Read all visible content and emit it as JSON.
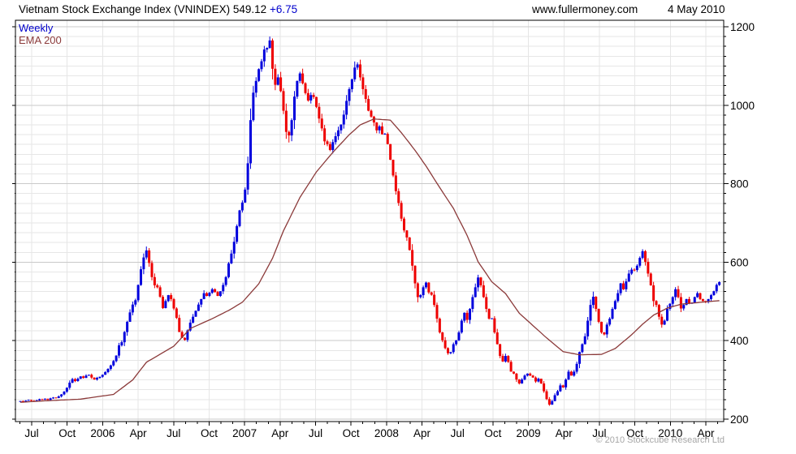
{
  "header": {
    "title": "Vietnam Stock Exchange Index (VNINDEX)",
    "last_value": "549.12",
    "change": "+6.75",
    "site": "www.fullermoney.com",
    "date": "4 May 2010"
  },
  "legend": {
    "series1": "Weekly",
    "series2": "EMA 200"
  },
  "footer": {
    "copyright": "© 2010 Stockcube Research Ltd"
  },
  "colors": {
    "up": "#0000dd",
    "down": "#ee0000",
    "ema": "#8b3a3a",
    "grid_minor": "#e6e6e6",
    "grid_major": "#c9c9c9",
    "axis": "#000000",
    "label": "#000000",
    "change_text": "#0000cc",
    "copyright_text": "#a6a6a6"
  },
  "chart_data": {
    "type": "candlestick",
    "title": "Vietnam Stock Exchange Index (VNINDEX)",
    "frequency": "Weekly",
    "overlay": "EMA 200",
    "last": 549.12,
    "change": 6.75,
    "date": "4 May 2010",
    "start": "Jun 2005",
    "end": "May 2010",
    "ylim": [
      200,
      1200
    ],
    "y_ticks": [
      1200,
      1000,
      800,
      600,
      400,
      200
    ],
    "y_minor_step": 25,
    "x_tick_labels": [
      "Jul",
      "Oct",
      "2006",
      "Apr",
      "Jul",
      "Oct",
      "2007",
      "Apr",
      "Jul",
      "Oct",
      "2008",
      "Apr",
      "Jul",
      "Oct",
      "2009",
      "Apr",
      "Jul",
      "Oct",
      "2010",
      "Apr"
    ],
    "grid": true,
    "legend_position": "top-left",
    "weekly_closes": [
      246,
      244,
      247,
      249,
      247,
      246,
      248,
      251,
      250,
      252,
      249,
      253,
      255,
      254,
      258,
      263,
      270,
      280,
      293,
      302,
      297,
      303,
      309,
      305,
      311,
      313,
      306,
      301,
      305,
      308,
      313,
      320,
      328,
      337,
      348,
      362,
      388,
      396,
      422,
      448,
      472,
      492,
      503,
      542,
      582,
      612,
      630,
      598,
      562,
      541,
      536,
      512,
      483,
      501,
      516,
      506,
      482,
      458,
      422,
      407,
      402,
      426,
      446,
      461,
      476,
      492,
      506,
      521,
      514,
      522,
      531,
      524,
      514,
      526,
      542,
      562,
      597,
      622,
      652,
      692,
      732,
      752,
      785,
      852,
      962,
      1032,
      1062,
      1092,
      1112,
      1142,
      1146,
      1165,
      1093,
      1052,
      1071,
      1036,
      986,
      932,
      923,
      962,
      1022,
      1062,
      1081,
      1056,
      1031,
      1012,
      1026,
      1021,
      996,
      966,
      941,
      908,
      901,
      886,
      906,
      921,
      936,
      951,
      976,
      1011,
      1041,
      1066,
      1096,
      1104,
      1071,
      1041,
      1016,
      986,
      971,
      956,
      936,
      946,
      926,
      927,
      901,
      861,
      821,
      781,
      751,
      711,
      681,
      663,
      631,
      591,
      546,
      511,
      516,
      536,
      548,
      523,
      517,
      491,
      456,
      421,
      401,
      381,
      368,
      371,
      391,
      401,
      421,
      451,
      471,
      453,
      481,
      511,
      536,
      561,
      541,
      511,
      481,
      456,
      457,
      421,
      391,
      361,
      347,
      361,
      346,
      321,
      316,
      301,
      291,
      301,
      311,
      316,
      311,
      306,
      296,
      303,
      291,
      271,
      251,
      237,
      246,
      261,
      271,
      286,
      281,
      301,
      321,
      311,
      321,
      341,
      371,
      391,
      411,
      451,
      491,
      512,
      481,
      448,
      421,
      416,
      441,
      456,
      481,
      501,
      521,
      546,
      531,
      551,
      571,
      581,
      580,
      591,
      611,
      628,
      601,
      571,
      541,
      501,
      491,
      461,
      441,
      451,
      481,
      494,
      511,
      531,
      511,
      482,
      491,
      506,
      496,
      496,
      511,
      521,
      506,
      501,
      499,
      506,
      516,
      526,
      542,
      549.12
    ],
    "extremes": {
      "46": {
        "high": 640
      },
      "47": {
        "high": 636
      },
      "91": {
        "high": 1175
      },
      "92": {
        "high": 1170
      },
      "98": {
        "low": 905
      },
      "113": {
        "low": 883
      },
      "156": {
        "low": 364
      },
      "167": {
        "high": 568
      },
      "193": {
        "low": 234
      },
      "209": {
        "high": 525
      },
      "227": {
        "high": 633
      },
      "228": {
        "high": 631
      },
      "234": {
        "low": 433
      }
    },
    "ema_points": [
      [
        0,
        243
      ],
      [
        10,
        247
      ],
      [
        22,
        251
      ],
      [
        34,
        263
      ],
      [
        41,
        300
      ],
      [
        46,
        345
      ],
      [
        56,
        386
      ],
      [
        62,
        431
      ],
      [
        70,
        456
      ],
      [
        76,
        477
      ],
      [
        81,
        498
      ],
      [
        87,
        545
      ],
      [
        92,
        610
      ],
      [
        96,
        680
      ],
      [
        102,
        765
      ],
      [
        108,
        830
      ],
      [
        114,
        880
      ],
      [
        120,
        925
      ],
      [
        124,
        950
      ],
      [
        129,
        965
      ],
      [
        135,
        962
      ],
      [
        139,
        930
      ],
      [
        144,
        885
      ],
      [
        148,
        845
      ],
      [
        153,
        790
      ],
      [
        158,
        737
      ],
      [
        163,
        668
      ],
      [
        167,
        601
      ],
      [
        172,
        550
      ],
      [
        177,
        520
      ],
      [
        182,
        470
      ],
      [
        192,
        407
      ],
      [
        198,
        372
      ],
      [
        204,
        364
      ],
      [
        212,
        365
      ],
      [
        217,
        380
      ],
      [
        223,
        415
      ],
      [
        227,
        442
      ],
      [
        231,
        465
      ],
      [
        236,
        483
      ],
      [
        241,
        493
      ],
      [
        247,
        497
      ],
      [
        255,
        502
      ]
    ]
  }
}
